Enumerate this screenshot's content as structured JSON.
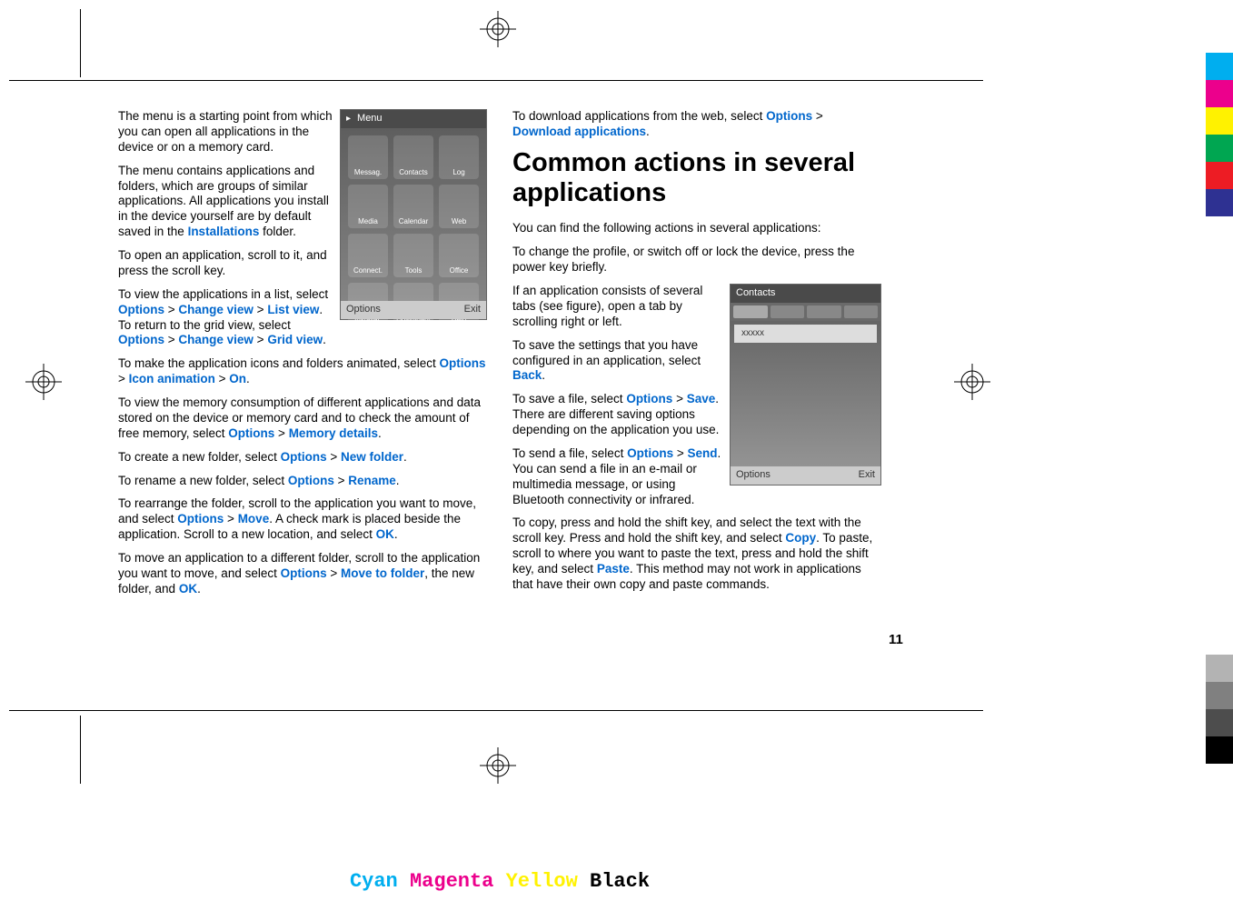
{
  "page_number": "11",
  "col1": {
    "p1": "The menu is a starting point from which you can open all applications in the device or on a memory card.",
    "p2a": "The menu contains applications and folders, which are groups of similar applications. All applications you install in the device yourself are by default saved in the ",
    "p2_hl": "Installations",
    "p2b": " folder.",
    "p3": "To open an application, scroll to it, and press the scroll key.",
    "p4a": "To view the applications in a list, select ",
    "opt": "Options",
    "gt": " > ",
    "changeview": "Change view",
    "listview": "List view",
    "p4b": ". To return to the grid view, select ",
    "gridview": "Grid view",
    "p4c": ".",
    "p5a": "To make the application icons and folders animated, select ",
    "iconanim": "Icon animation",
    "on": "On",
    "p5b": ".",
    "p6a": "To view the memory consumption of different applications and data stored on the device or memory card and to check the amount of free memory, select ",
    "memdet": "Memory details",
    "p6b": ".",
    "p7a": "To create a new folder, select ",
    "newfolder": "New folder",
    "p7b": ".",
    "p8a": "To rename a new folder, select ",
    "rename": "Rename",
    "p8b": ".",
    "p9a": "To rearrange the folder, scroll to the application you want to move, and select ",
    "move": "Move",
    "p9b": ". A check mark is placed beside the application. Scroll to a new location, and select ",
    "ok": "OK",
    "p9c": ".",
    "p10a": "To move an application to a different folder, scroll to the application you want to move, and select ",
    "movetofolder": "Move to folder",
    "p10b": ", the new folder, and ",
    "p10c": "."
  },
  "col2": {
    "p1a": "To download applications from the web, select ",
    "dlapps": "Download applications",
    "p1b": ".",
    "heading": "Common actions in several applications",
    "p2": "You can find the following actions in several applications:",
    "p3": "To change the profile, or switch off or lock the device, press the power key briefly.",
    "p4": "If an application consists of several tabs (see figure), open a tab by scrolling right or left.",
    "p5a": "To save the settings that you have configured in an application, select ",
    "back": "Back",
    "p5b": ".",
    "p6a": "To save a file, select ",
    "save": "Save",
    "p6b": ". There are different saving options depending on the application you use.",
    "p7a": "To send a file, select ",
    "send": "Send",
    "p7b": ". You can send a file in an e-mail or multimedia message, or using Bluetooth connectivity or infrared.",
    "p8a": "To copy, press and hold the shift key, and select the text with the scroll key. Press and hold the shift key, and select ",
    "copy": "Copy",
    "p8b": ". To paste, scroll to where you want to paste the text, press and hold the shift key, and select ",
    "paste": "Paste",
    "p8c": ". This method may not work in applications that have their own copy and paste commands."
  },
  "screenshot1": {
    "title": "Menu",
    "cells": [
      "Messag.",
      "Contacts",
      "Log",
      "Media",
      "Calendar",
      "Web",
      "Connect.",
      "Tools",
      "Office",
      "Installat.",
      "Download!",
      "Help"
    ],
    "left_softkey": "Options",
    "right_softkey": "Exit"
  },
  "screenshot2": {
    "title": "Contacts",
    "row": "xxxxx",
    "left_softkey": "Options",
    "right_softkey": "Exit"
  },
  "cmyk": {
    "cyan": "Cyan",
    "magenta": "Magenta",
    "yellow": "Yellow",
    "black": "Black"
  },
  "color_bars_top": [
    "#00aeef",
    "#ec008c",
    "#fff200",
    "#00a651",
    "#ed1c24",
    "#2e3192"
  ],
  "color_bars_bottom": [
    "#ffffff",
    "#b3b3b3",
    "#808080",
    "#4d4d4d",
    "#000000"
  ]
}
